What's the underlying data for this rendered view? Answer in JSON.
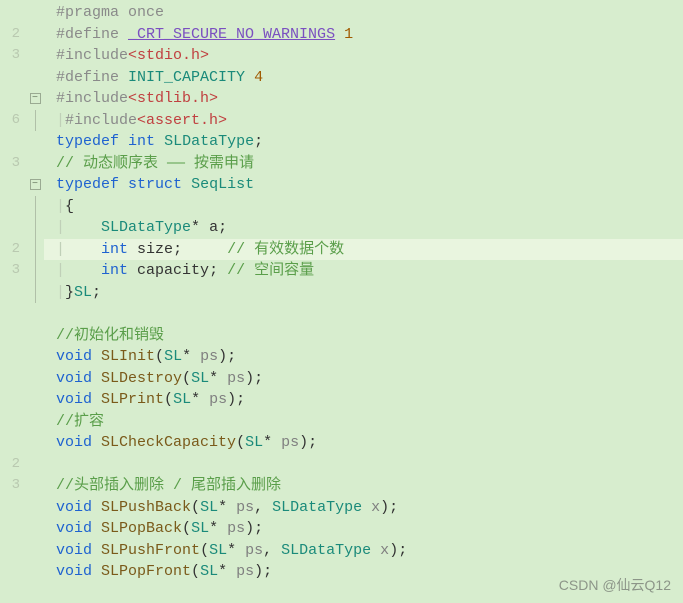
{
  "gutter_numbers": [
    "",
    "2",
    "3",
    "",
    "",
    "6",
    "",
    "3",
    "",
    "",
    "",
    "2",
    "3",
    "",
    "",
    "",
    "",
    "",
    "",
    "",
    "",
    "2",
    "3",
    "",
    "",
    ""
  ],
  "fold_markers": [
    "",
    "",
    "",
    "",
    "box",
    "bar",
    "",
    "",
    "box",
    "bar",
    "bar",
    "bar",
    "bar",
    "bar",
    "",
    "",
    "",
    "",
    "",
    "",
    "",
    "",
    "",
    "",
    "",
    "",
    ""
  ],
  "tokens": [
    [
      {
        "t": "#pragma",
        "c": "pp"
      },
      {
        "t": " "
      },
      {
        "t": "once",
        "c": "pp"
      }
    ],
    [
      {
        "t": "#define",
        "c": "pp"
      },
      {
        "t": " "
      },
      {
        "t": "_CRT_SECURE_NO_WARNINGS",
        "c": "macro"
      },
      {
        "t": " "
      },
      {
        "t": "1",
        "c": "num"
      }
    ],
    [
      {
        "t": "#include",
        "c": "pp"
      },
      {
        "t": "<stdio.h>",
        "c": "str"
      }
    ],
    [
      {
        "t": "#define",
        "c": "pp"
      },
      {
        "t": " "
      },
      {
        "t": "INIT_CAPACITY",
        "c": "cls"
      },
      {
        "t": " "
      },
      {
        "t": "4",
        "c": "num"
      }
    ],
    [
      {
        "t": "#include",
        "c": "pp"
      },
      {
        "t": "<stdlib.h>",
        "c": "str"
      }
    ],
    [
      {
        "t": "#include",
        "c": "pp"
      },
      {
        "t": "<assert.h>",
        "c": "str"
      }
    ],
    [
      {
        "t": "typedef",
        "c": "kw"
      },
      {
        "t": " "
      },
      {
        "t": "int",
        "c": "kw"
      },
      {
        "t": " "
      },
      {
        "t": "SLDataType",
        "c": "cls"
      },
      {
        "t": ";"
      }
    ],
    [
      {
        "t": "// 动态顺序表 —— 按需申请",
        "c": "comment"
      }
    ],
    [
      {
        "t": "typedef",
        "c": "kw"
      },
      {
        "t": " "
      },
      {
        "t": "struct",
        "c": "kw"
      },
      {
        "t": " "
      },
      {
        "t": "SeqList",
        "c": "cls"
      }
    ],
    [
      {
        "t": "{",
        "indent": 0
      }
    ],
    [
      {
        "t": "SLDataType",
        "c": "cls",
        "indent": 1
      },
      {
        "t": "* "
      },
      {
        "t": "a"
      },
      {
        "t": ";"
      }
    ],
    [
      {
        "t": "int",
        "c": "kw",
        "indent": 1
      },
      {
        "t": " "
      },
      {
        "t": "size"
      },
      {
        "t": ";     "
      },
      {
        "t": "// 有效数据个数",
        "c": "comment"
      }
    ],
    [
      {
        "t": "int",
        "c": "kw",
        "indent": 1
      },
      {
        "t": " "
      },
      {
        "t": "capacity"
      },
      {
        "t": "; "
      },
      {
        "t": "// 空间容量",
        "c": "comment"
      }
    ],
    [
      {
        "t": "}",
        "indent": -1
      },
      {
        "t": "SL",
        "c": "cls"
      },
      {
        "t": ";"
      }
    ],
    [],
    [
      {
        "t": "//初始化和销毁",
        "c": "comment"
      }
    ],
    [
      {
        "t": "void",
        "c": "kw"
      },
      {
        "t": " "
      },
      {
        "t": "SLInit",
        "c": "fn"
      },
      {
        "t": "("
      },
      {
        "t": "SL",
        "c": "cls"
      },
      {
        "t": "* "
      },
      {
        "t": "ps",
        "c": "param"
      },
      {
        "t": ");"
      }
    ],
    [
      {
        "t": "void",
        "c": "kw"
      },
      {
        "t": " "
      },
      {
        "t": "SLDestroy",
        "c": "fn"
      },
      {
        "t": "("
      },
      {
        "t": "SL",
        "c": "cls"
      },
      {
        "t": "* "
      },
      {
        "t": "ps",
        "c": "param"
      },
      {
        "t": ");"
      }
    ],
    [
      {
        "t": "void",
        "c": "kw"
      },
      {
        "t": " "
      },
      {
        "t": "SLPrint",
        "c": "fn"
      },
      {
        "t": "("
      },
      {
        "t": "SL",
        "c": "cls"
      },
      {
        "t": "* "
      },
      {
        "t": "ps",
        "c": "param"
      },
      {
        "t": ");"
      }
    ],
    [
      {
        "t": "//扩容",
        "c": "comment"
      }
    ],
    [
      {
        "t": "void",
        "c": "kw"
      },
      {
        "t": " "
      },
      {
        "t": "SLCheckCapacity",
        "c": "fn"
      },
      {
        "t": "("
      },
      {
        "t": "SL",
        "c": "cls"
      },
      {
        "t": "* "
      },
      {
        "t": "ps",
        "c": "param"
      },
      {
        "t": ");"
      }
    ],
    [],
    [
      {
        "t": "//头部插入删除 / 尾部插入删除",
        "c": "comment"
      }
    ],
    [
      {
        "t": "void",
        "c": "kw"
      },
      {
        "t": " "
      },
      {
        "t": "SLPushBack",
        "c": "fn"
      },
      {
        "t": "("
      },
      {
        "t": "SL",
        "c": "cls"
      },
      {
        "t": "* "
      },
      {
        "t": "ps",
        "c": "param"
      },
      {
        "t": ", "
      },
      {
        "t": "SLDataType",
        "c": "cls"
      },
      {
        "t": " "
      },
      {
        "t": "x",
        "c": "param"
      },
      {
        "t": ");"
      }
    ],
    [
      {
        "t": "void",
        "c": "kw"
      },
      {
        "t": " "
      },
      {
        "t": "SLPopBack",
        "c": "fn"
      },
      {
        "t": "("
      },
      {
        "t": "SL",
        "c": "cls"
      },
      {
        "t": "* "
      },
      {
        "t": "ps",
        "c": "param"
      },
      {
        "t": ");"
      }
    ],
    [
      {
        "t": "void",
        "c": "kw"
      },
      {
        "t": " "
      },
      {
        "t": "SLPushFront",
        "c": "fn"
      },
      {
        "t": "("
      },
      {
        "t": "SL",
        "c": "cls"
      },
      {
        "t": "* "
      },
      {
        "t": "ps",
        "c": "param"
      },
      {
        "t": ", "
      },
      {
        "t": "SLDataType",
        "c": "cls"
      },
      {
        "t": " "
      },
      {
        "t": "x",
        "c": "param"
      },
      {
        "t": ");"
      }
    ],
    [
      {
        "t": "void",
        "c": "kw"
      },
      {
        "t": " "
      },
      {
        "t": "SLPopFront",
        "c": "fn"
      },
      {
        "t": "("
      },
      {
        "t": "SL",
        "c": "cls"
      },
      {
        "t": "* "
      },
      {
        "t": "ps",
        "c": "param"
      },
      {
        "t": ");"
      }
    ]
  ],
  "highlight_line": 11,
  "line5_prefix": true,
  "watermark": "CSDN @仙云Q12"
}
